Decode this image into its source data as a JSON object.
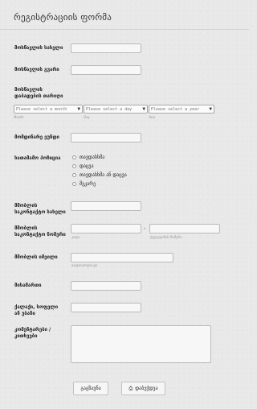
{
  "form": {
    "title": "რეგისტრაციის ფორმა",
    "student_name_label": "მოსწავლის სახელი",
    "student_surname_label": "მოსწავლის გვარი",
    "birthdate_label_1": "მოსწავლის",
    "birthdate_label_2": "დაბადების თარიღი",
    "month": {
      "placeholder": "Please select a month",
      "sublabel": "Month"
    },
    "day": {
      "placeholder": "Please select a day",
      "sublabel": "Day"
    },
    "year": {
      "placeholder": "Please select a year",
      "sublabel": "Year"
    },
    "email_label": "მომდინარე ეუნდი",
    "interests_label": "ხათამამო პოზიცია",
    "options": [
      "თავდასხმა",
      "დაცვა",
      "თავდასხმა ან დაცვა",
      "მეკარე"
    ],
    "parent_name_label_1": "მშობლის",
    "parent_name_label_2": "საკონტაქტო სახელი",
    "parent_phone_label_1": "მშობლის",
    "parent_phone_label_2": "საკონტაქტო ნომერი",
    "phone_area_sublabel": "კოდი",
    "phone_number_sublabel": "ტელეფონის ნომერი",
    "parent_email_label": "მშობლის იმეილი",
    "parent_email_placeholder": "ex@example.ge",
    "address_label": "მისამართი",
    "city_label_1": "ქალაქი, სოფელი",
    "city_label_2": "ან უბანი",
    "comments_label_1": "კომენტარები /",
    "comments_label_2": "კითხვები",
    "clear_button": "გაგზავნა",
    "print_button": "დაბეჭდვა",
    "print_icon": "printer-icon"
  }
}
